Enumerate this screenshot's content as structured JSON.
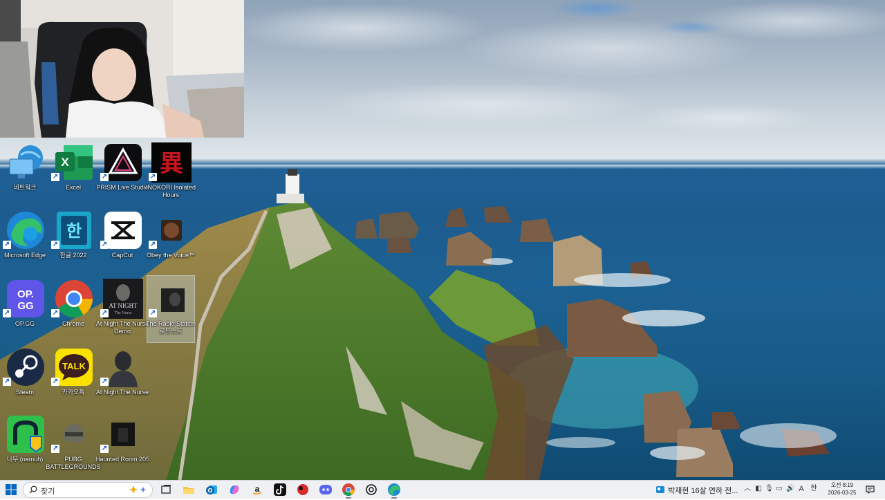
{
  "desktop": {
    "icons": [
      {
        "label": "네트워크",
        "icon": "network-icon",
        "shortcut": false
      },
      {
        "label": "Excel",
        "icon": "excel-icon",
        "shortcut": true
      },
      {
        "label": "PRISM Live Studio",
        "icon": "prism-icon",
        "shortcut": true
      },
      {
        "label": "INOKORI Isolated Hours",
        "icon": "inokori-icon",
        "shortcut": true
      },
      {
        "label": "Microsoft Edge",
        "icon": "edge-icon",
        "shortcut": true
      },
      {
        "label": "한글 2022",
        "icon": "hangul-icon",
        "shortcut": true
      },
      {
        "label": "CapCut",
        "icon": "capcut-icon",
        "shortcut": true
      },
      {
        "label": "Obey the Voice™",
        "icon": "obey-voice-icon",
        "shortcut": true
      },
      {
        "label": "OP.GG",
        "icon": "opgg-icon",
        "shortcut": true
      },
      {
        "label": "Chrome",
        "icon": "chrome-icon",
        "shortcut": true
      },
      {
        "label": "At Night The Nurse Demo",
        "icon": "at-night-demo-icon",
        "shortcut": true
      },
      {
        "label": "The Radio Station 로드스트",
        "icon": "radio-station-icon",
        "shortcut": true
      },
      {
        "label": "Steam",
        "icon": "steam-icon",
        "shortcut": true
      },
      {
        "label": "카카오톡",
        "icon": "kakaotalk-icon",
        "shortcut": true
      },
      {
        "label": "At Night The Nurse",
        "icon": "at-night-icon",
        "shortcut": true
      },
      {
        "label": "나무 (namuh)",
        "icon": "namuh-icon",
        "shortcut": false
      },
      {
        "label": "PUBG BATTLEGROUNDS",
        "icon": "pubg-icon",
        "shortcut": true
      },
      {
        "label": "Haunted Room 205",
        "icon": "haunted-room-icon",
        "shortcut": true
      }
    ],
    "excel_letter": "X",
    "inokori_glyph": "異",
    "hangul_glyph": "한",
    "opgg_text_1": "OP.",
    "opgg_text_2": "GG",
    "kakao_text": "TALK",
    "at_night_demo_text": "AT NIGHT",
    "at_night_demo_sub": "The Nurse"
  },
  "taskbar": {
    "search_placeholder": "찾기",
    "pinned": [
      "task-view",
      "file-explorer",
      "outlook",
      "copilot",
      "amazon",
      "tiktok",
      "app-red",
      "discord",
      "chrome",
      "chatgpt",
      "edge"
    ],
    "news": "박재현 16살 연하 전...",
    "ime": "A",
    "lang": "한",
    "time": "오전 8:19",
    "date": "2026-03-25"
  },
  "colors": {
    "taskbar_bg": "#eef0f3",
    "accent": "#0067c0"
  }
}
